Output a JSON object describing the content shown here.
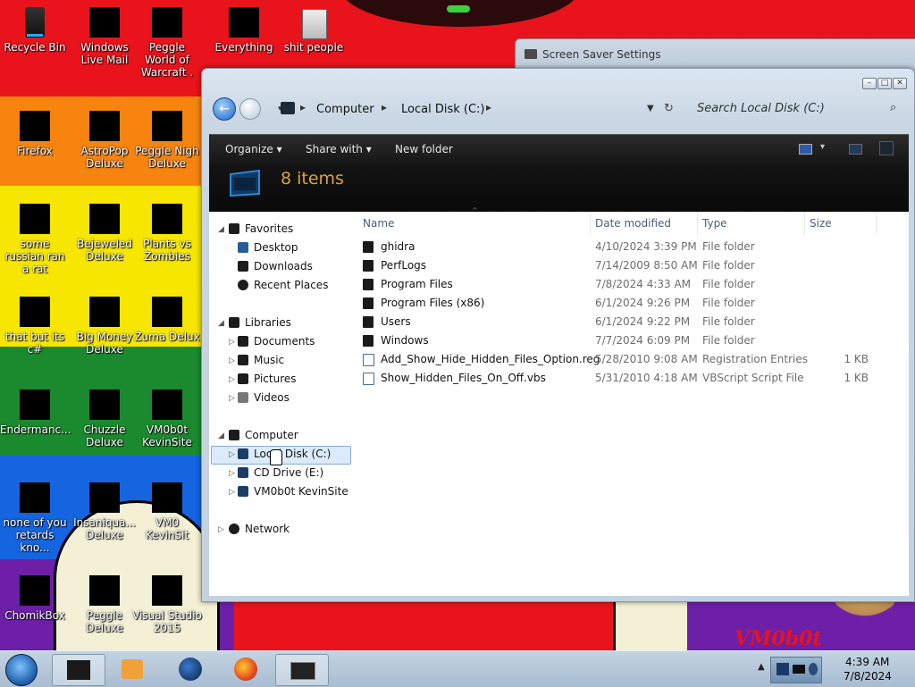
{
  "desktop": {
    "icons": [
      {
        "label": "Recycle Bin"
      },
      {
        "label": "Windows Live Mail"
      },
      {
        "label": "Peggle World of Warcraft ."
      },
      {
        "label": "Everything"
      },
      {
        "label": "shit people"
      },
      {
        "label": "Firefox"
      },
      {
        "label": "AstroPop Deluxe"
      },
      {
        "label": "Peggle Nigh Deluxe"
      },
      {
        "label": "some russian ran a rat"
      },
      {
        "label": "Bejeweled Deluxe"
      },
      {
        "label": "Plants vs Zombies"
      },
      {
        "label": "that but its c#"
      },
      {
        "label": "Big Money Deluxe"
      },
      {
        "label": "Zuma Delux"
      },
      {
        "label": "Endermanc..."
      },
      {
        "label": "Chuzzle Deluxe"
      },
      {
        "label": "VM0b0t KevinSite"
      },
      {
        "label": "none of you retards kno..."
      },
      {
        "label": "Insaniqua... Deluxe"
      },
      {
        "label": "VM0 KevinSit"
      },
      {
        "label": "ChomikBox"
      },
      {
        "label": "Peggle Deluxe"
      },
      {
        "label": "Visual Studio 2015"
      }
    ],
    "wallpaper_text": "VM0b0t",
    "wallpaper_colors": [
      "#e8131b",
      "#f7840f",
      "#f6e600",
      "#1b8a2e",
      "#1565e0",
      "#6d1fa7"
    ]
  },
  "screensaver_window": {
    "title": "Screen Saver Settings"
  },
  "explorer": {
    "address": {
      "computer": "Computer",
      "disk": "Local Disk (C:)"
    },
    "search_placeholder": "Search Local Disk (C:)",
    "toolbar": {
      "organize": "Organize",
      "share_with": "Share with",
      "new_folder": "New folder"
    },
    "items_count": "8 items",
    "nav": {
      "favorites": "Favorites",
      "desktop": "Desktop",
      "downloads": "Downloads",
      "recent_places": "Recent Places",
      "libraries": "Libraries",
      "documents": "Documents",
      "music": "Music",
      "pictures": "Pictures",
      "videos": "Videos",
      "computer": "Computer",
      "local_disk": "Local Disk (C:)",
      "cd_drive": "CD Drive (E:)",
      "vm_site": "VM0b0t KevinSite",
      "network": "Network"
    },
    "columns": {
      "name": "Name",
      "date": "Date modified",
      "type": "Type",
      "size": "Size"
    },
    "files": [
      {
        "name": "ghidra",
        "date": "4/10/2024 3:39 PM",
        "type": "File folder",
        "size": "",
        "kind": "folder"
      },
      {
        "name": "PerfLogs",
        "date": "7/14/2009 8:50 AM",
        "type": "File folder",
        "size": "",
        "kind": "folder"
      },
      {
        "name": "Program Files",
        "date": "7/8/2024 4:33 AM",
        "type": "File folder",
        "size": "",
        "kind": "folder"
      },
      {
        "name": "Program Files (x86)",
        "date": "6/1/2024 9:26 PM",
        "type": "File folder",
        "size": "",
        "kind": "folder"
      },
      {
        "name": "Users",
        "date": "6/1/2024 9:22 PM",
        "type": "File folder",
        "size": "",
        "kind": "folder"
      },
      {
        "name": "Windows",
        "date": "7/7/2024 6:09 PM",
        "type": "File folder",
        "size": "",
        "kind": "folder"
      },
      {
        "name": "Add_Show_Hide_Hidden_Files_Option.reg",
        "date": "5/28/2010 9:08 AM",
        "type": "Registration Entries",
        "size": "1 KB",
        "kind": "doc"
      },
      {
        "name": "Show_Hidden_Files_On_Off.vbs",
        "date": "5/31/2010 4:18 AM",
        "type": "VBScript Script File",
        "size": "1 KB",
        "kind": "doc"
      }
    ]
  },
  "taskbar": {
    "time": "4:39 AM",
    "date": "7/8/2024"
  }
}
